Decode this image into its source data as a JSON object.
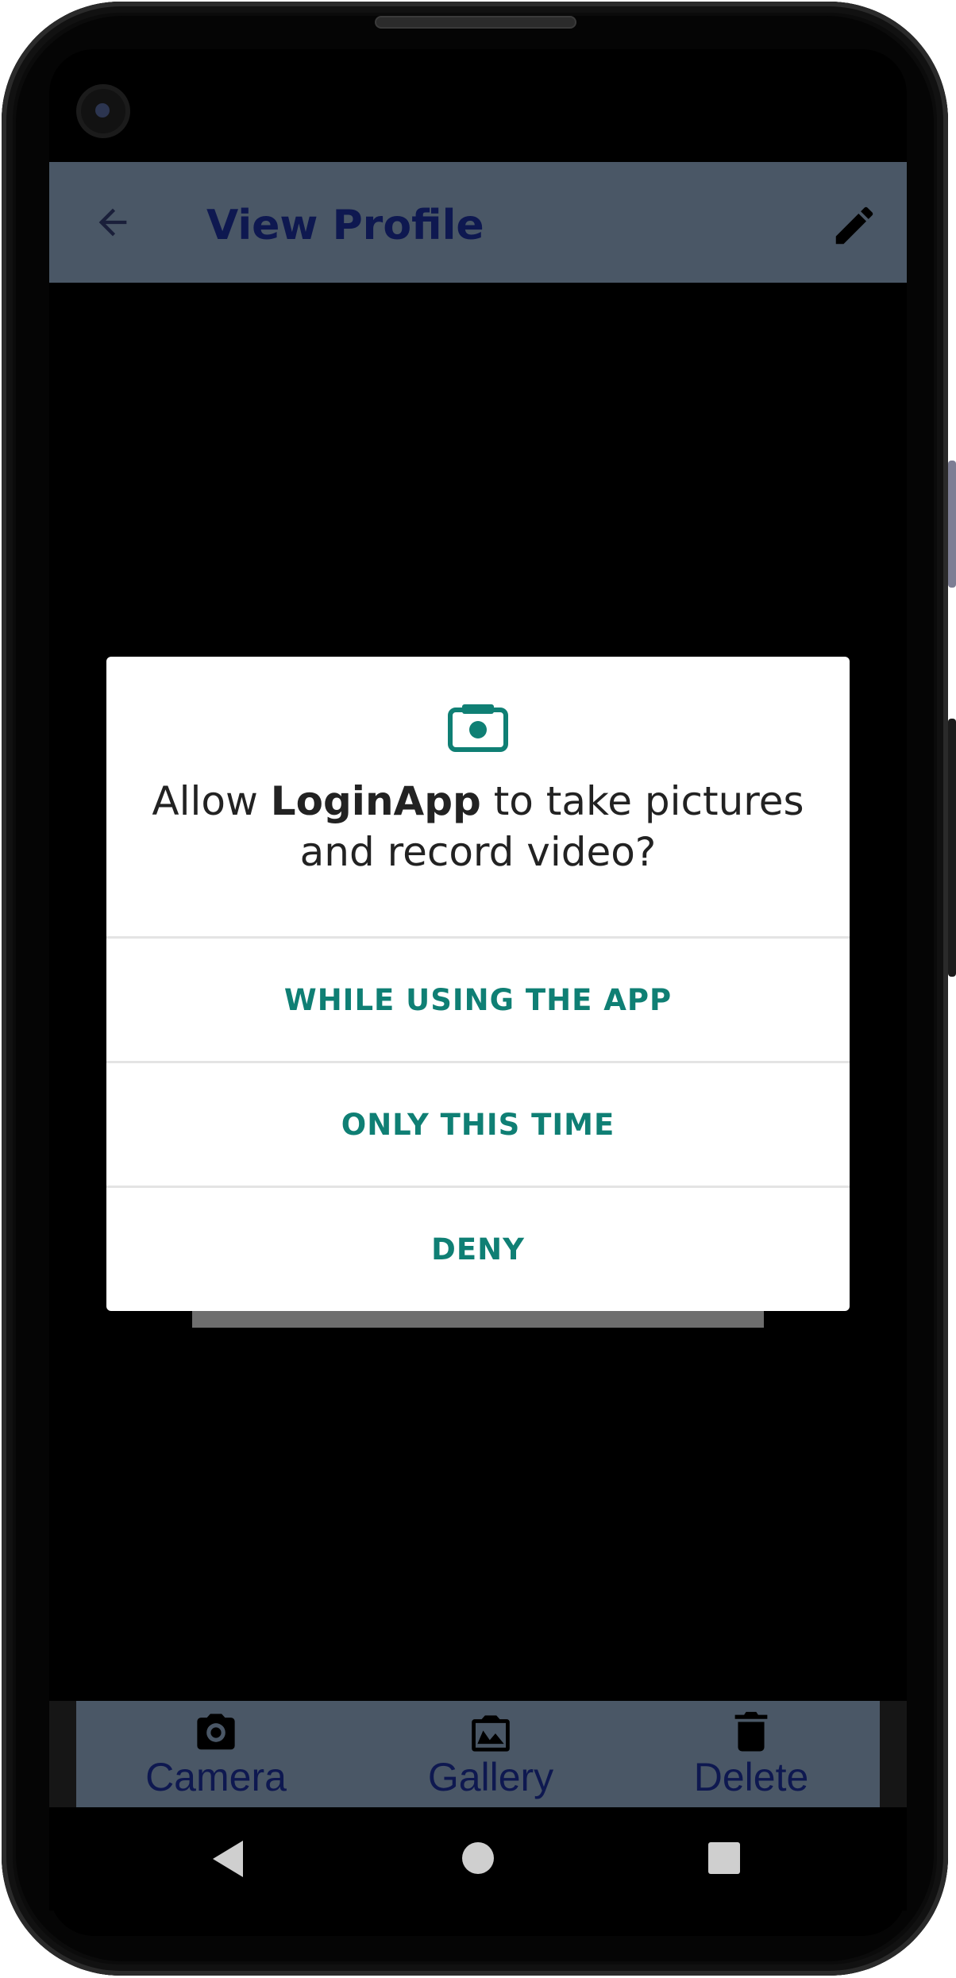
{
  "toolbar": {
    "title": "View Profile",
    "back_icon": "arrow-back-icon",
    "edit_icon": "pencil-icon",
    "background": "#4a5766",
    "title_color": "#0e1850"
  },
  "dialog": {
    "icon": "camera-icon",
    "message_prefix": "Allow ",
    "app_name": "LoginApp",
    "message_suffix": " to take pictures and record video?",
    "options": [
      {
        "label": "WHILE USING THE APP"
      },
      {
        "label": "ONLY THIS TIME"
      },
      {
        "label": "DENY"
      }
    ],
    "accent": "#0f7f74"
  },
  "bottom_bar": {
    "actions": [
      {
        "label": "Camera",
        "icon": "camera-icon"
      },
      {
        "label": "Gallery",
        "icon": "gallery-icon"
      },
      {
        "label": "Delete",
        "icon": "trash-icon"
      }
    ]
  },
  "system_nav": {
    "back": "nav-back-icon",
    "home": "nav-home-icon",
    "recents": "nav-recents-icon"
  }
}
